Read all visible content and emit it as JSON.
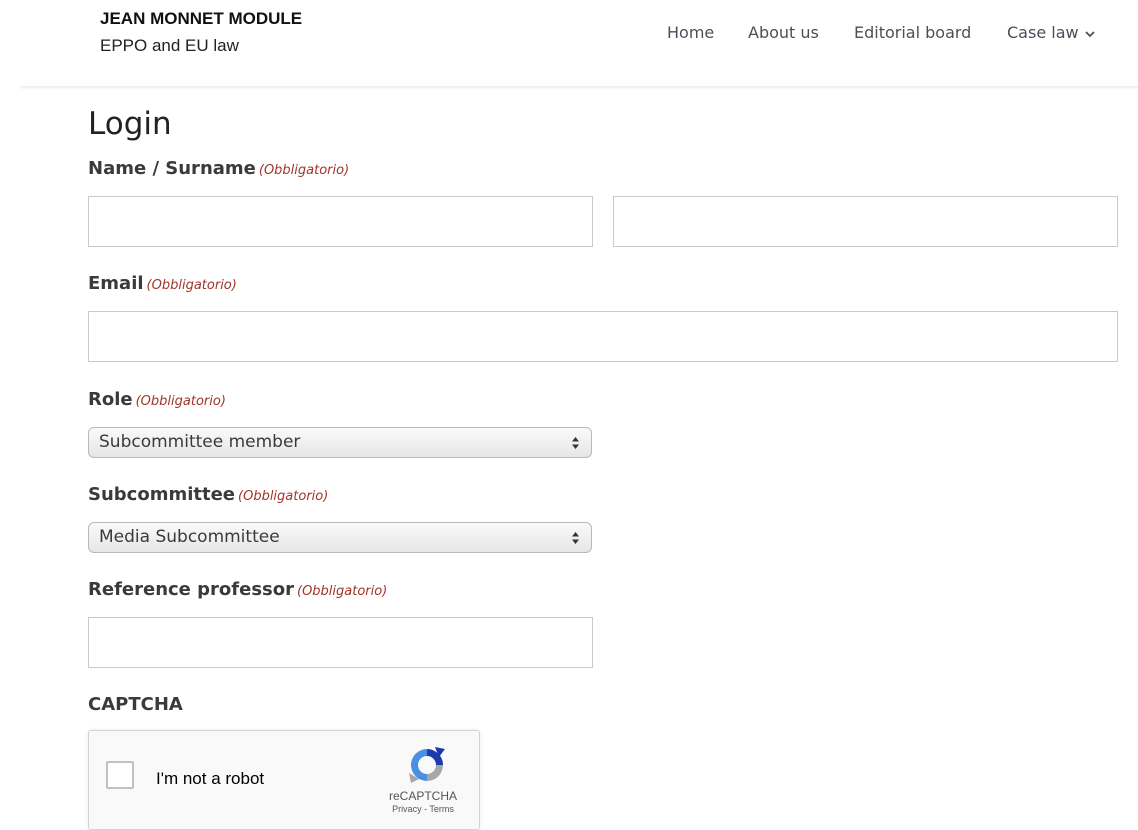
{
  "site": {
    "title": "JEAN MONNET MODULE",
    "subtitle": "EPPO and EU law"
  },
  "nav": {
    "items": [
      "Home",
      "About us",
      "Editorial board",
      "Case law"
    ]
  },
  "form": {
    "title": "Login",
    "required_marker": "(Obbligatorio)",
    "name_label": "Name / Surname",
    "first_name_value": "",
    "last_name_value": "",
    "email_label": "Email",
    "email_value": "",
    "role_label": "Role",
    "role_selected": "Subcommittee member",
    "subcommittee_label": "Subcommittee",
    "subcommittee_selected": "Media Subcommittee",
    "professor_label": "Reference professor",
    "professor_value": "",
    "captcha_label": "CAPTCHA"
  },
  "recaptcha": {
    "checkbox_label": "I'm not a robot",
    "brand": "reCAPTCHA",
    "privacy": "Privacy",
    "separator": " - ",
    "terms": "Terms",
    "logo_icon": "recaptcha-logo"
  },
  "colors": {
    "required": "#a0352a",
    "nav_text": "#4b4f58",
    "recaptcha_blue": "#4a90e2",
    "recaptcha_dark_blue": "#1c3aa9"
  }
}
